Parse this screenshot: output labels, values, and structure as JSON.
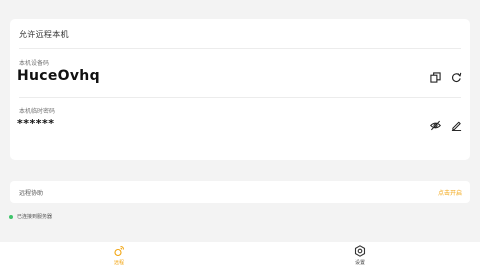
{
  "card": {
    "title": "允许远程本机",
    "code_label": "本机设备码",
    "code_value": "HuceOvhq",
    "password_label": "本机临时密码",
    "password_value": "******"
  },
  "control": {
    "label": "远程协助",
    "action": "点击开启"
  },
  "status": {
    "text": "已连接到服务器",
    "color": "#3ec46a"
  },
  "nav": {
    "remote_label": "远程",
    "settings_label": "设置"
  },
  "colors": {
    "accent": "#f2a511",
    "background": "#f3f3f3"
  }
}
